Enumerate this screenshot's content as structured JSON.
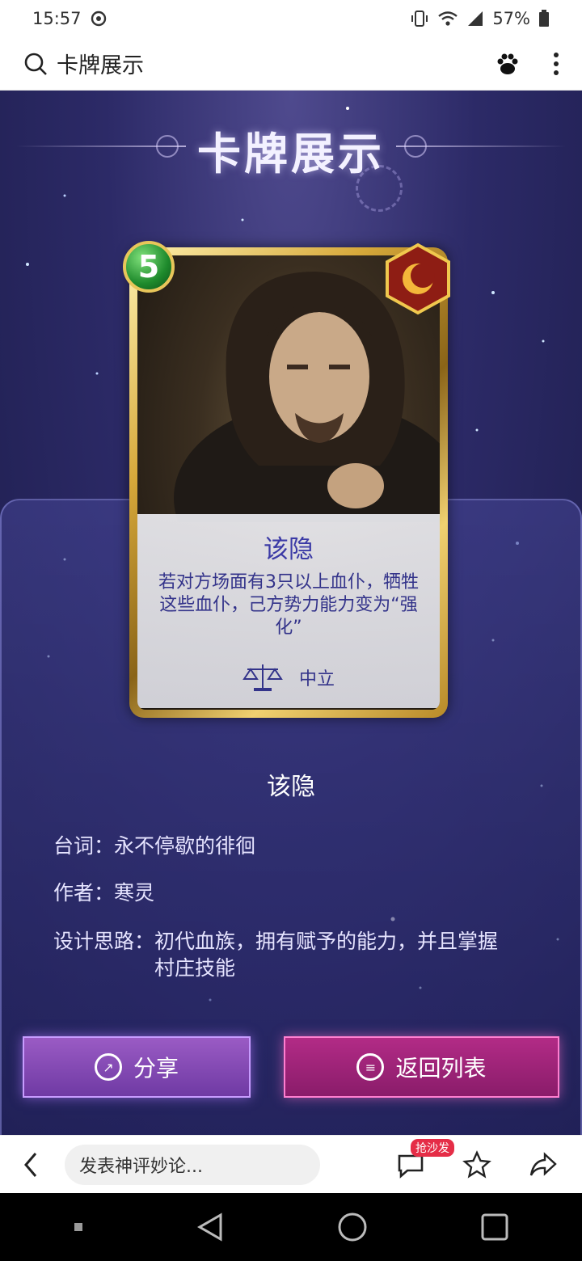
{
  "status_bar": {
    "time": "15:57",
    "battery": "57%"
  },
  "top_bar": {
    "title": "卡牌展示"
  },
  "hero": {
    "title": "卡牌展示"
  },
  "card": {
    "cost": "5",
    "name": "该隐",
    "description": "若对方场面有3只以上血仆，牺牲这些血仆，己方势力能力变为“强化”",
    "alignment": "中立"
  },
  "info": {
    "name": "该隐",
    "quote_label": "台词：",
    "quote": "永不停歇的徘徊",
    "author_label": "作者：",
    "author": "寒灵",
    "design_label": "设计思路：",
    "design": "初代血族，拥有赋予的能力，并且掌握村庄技能"
  },
  "buttons": {
    "share": "分享",
    "back": "返回列表"
  },
  "comment_bar": {
    "placeholder": "发表神评妙论...",
    "badge": "抢沙发"
  },
  "colors": {
    "stage_top": "#4f4a8e",
    "stage_bottom": "#1d1d4c",
    "share_btn": "#7f45b0",
    "back_btn": "#a0237a",
    "card_text": "#3b3aa6"
  }
}
